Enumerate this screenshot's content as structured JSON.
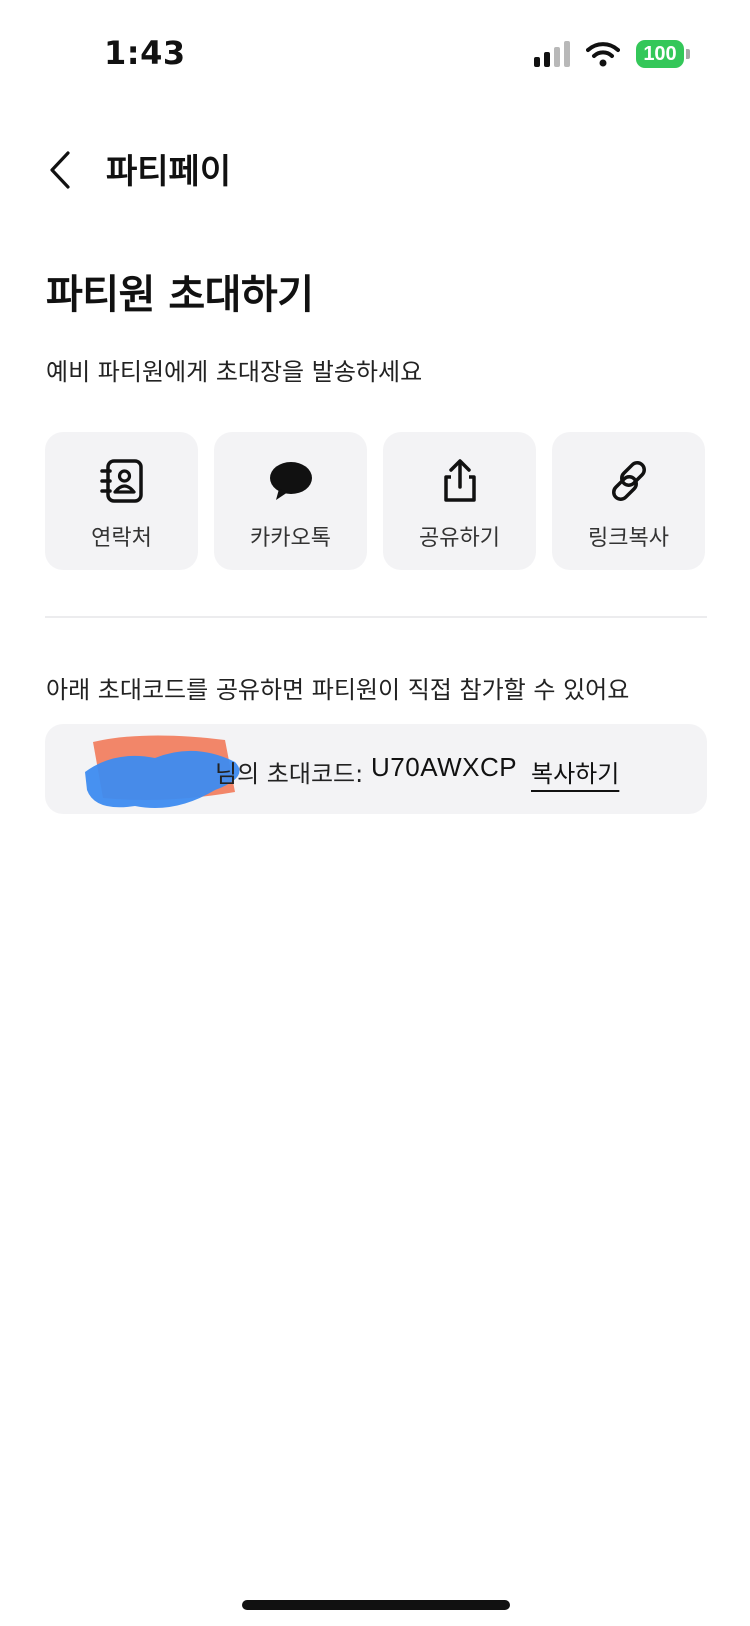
{
  "status_bar": {
    "time": "1:43",
    "battery": "100",
    "battery_color": "#34c759",
    "icons": [
      "signal-icon",
      "wifi-icon",
      "battery-icon"
    ]
  },
  "nav": {
    "back_icon": "chevron-left-icon",
    "title": "파티페이"
  },
  "page": {
    "title": "파티원 초대하기",
    "subtitle": "예비 파티원에게 초대장을 발송하세요"
  },
  "actions": [
    {
      "label": "연락처",
      "icon": "contact-book-icon"
    },
    {
      "label": "카카오톡",
      "icon": "chat-bubble-icon"
    },
    {
      "label": "공유하기",
      "icon": "share-icon"
    },
    {
      "label": "링크복사",
      "icon": "link-icon"
    }
  ],
  "invite": {
    "description": "아래 초대코드를 공유하면 파티원이 직접 참가할 수 있어요",
    "owner_suffix": "님의 초대코드:",
    "code": "U70AWXCP",
    "copy_label": "복사하기"
  },
  "colors": {
    "tile_bg": "#f3f3f5",
    "text": "#111111"
  }
}
